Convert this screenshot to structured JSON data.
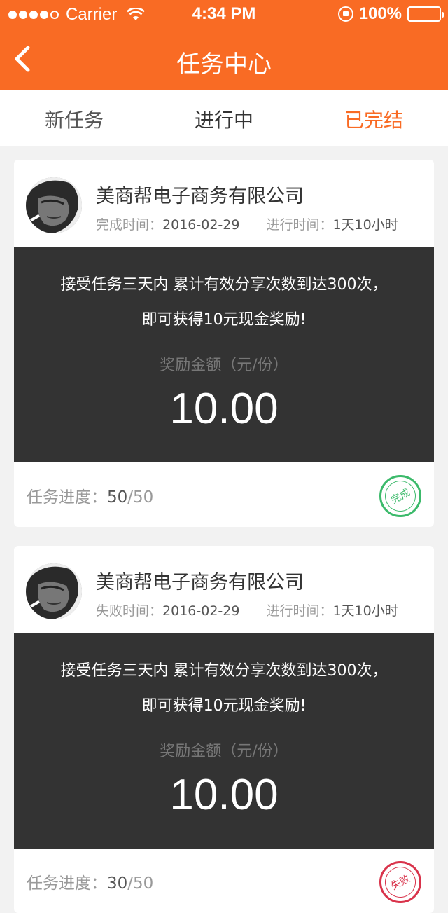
{
  "colors": {
    "accent": "#f96b24",
    "dark_panel": "#333333",
    "success": "#3cba6b",
    "fail": "#d9334b"
  },
  "status_bar": {
    "carrier": "Carrier",
    "time": "4:34 PM",
    "battery": "100%"
  },
  "nav": {
    "title": "任务中心",
    "back_icon": "chevron-left-icon"
  },
  "tabs": [
    {
      "label": "新任务"
    },
    {
      "label": "进行中"
    },
    {
      "label": "已完结",
      "active": true
    }
  ],
  "tasks": [
    {
      "company": "美商帮电子商务有限公司",
      "time_label": "完成时间：",
      "time_value": "2016-02-29",
      "duration_label": "进行时间：",
      "duration_value": "1天10小时",
      "desc_line1": "接受任务三天内 累计有效分享次数到达300次，",
      "desc_line2": "即可获得10元现金奖励!",
      "reward_label": "奖励金额（元/份）",
      "amount": "10.00",
      "progress_label": "任务进度：",
      "progress_done": "50",
      "progress_total": "/50",
      "stamp": "完成"
    },
    {
      "company": "美商帮电子商务有限公司",
      "time_label": "失败时间：",
      "time_value": "2016-02-29",
      "duration_label": "进行时间：",
      "duration_value": "1天10小时",
      "desc_line1": "接受任务三天内 累计有效分享次数到达300次，",
      "desc_line2": "即可获得10元现金奖励!",
      "reward_label": "奖励金额（元/份）",
      "amount": "10.00",
      "progress_label": "任务进度：",
      "progress_done": "30",
      "progress_total": "/50",
      "stamp": "失败"
    }
  ]
}
